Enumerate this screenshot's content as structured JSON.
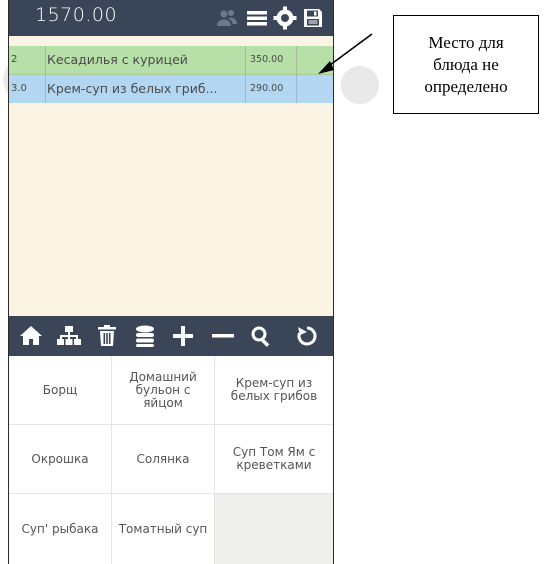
{
  "header": {
    "total": "1570.00",
    "icons": [
      "users-icon",
      "menu-icon",
      "settings-icon",
      "save-icon"
    ]
  },
  "order": {
    "rows": [
      {
        "qty": "2",
        "name": "Кесадилья с курицей",
        "price": "350.00",
        "color": "#b7e0a8"
      },
      {
        "qty": "3.0",
        "name": "Крем-суп из белых гриб...",
        "price": "290.00",
        "color": "#b3d7f2"
      }
    ]
  },
  "toolbar": {
    "icons": [
      "home-icon",
      "sitemap-icon",
      "trash-icon",
      "database-icon",
      "plus-icon",
      "minus-icon",
      "search-icon",
      "refresh-icon"
    ]
  },
  "dishes": [
    "Борщ",
    "Домашний бульон с яйцом",
    "Крем-суп из белых грибов",
    "Окрошка",
    "Солянка",
    "Суп Том Ям с креветками",
    "Суп' рыбака",
    "Томатный суп"
  ],
  "callout": {
    "text": "Место для блюда не определено"
  },
  "colors": {
    "bar": "#3a4658",
    "background": "#fbf3e4",
    "row_green": "#b7e0a8",
    "row_blue": "#b3d7f2"
  }
}
